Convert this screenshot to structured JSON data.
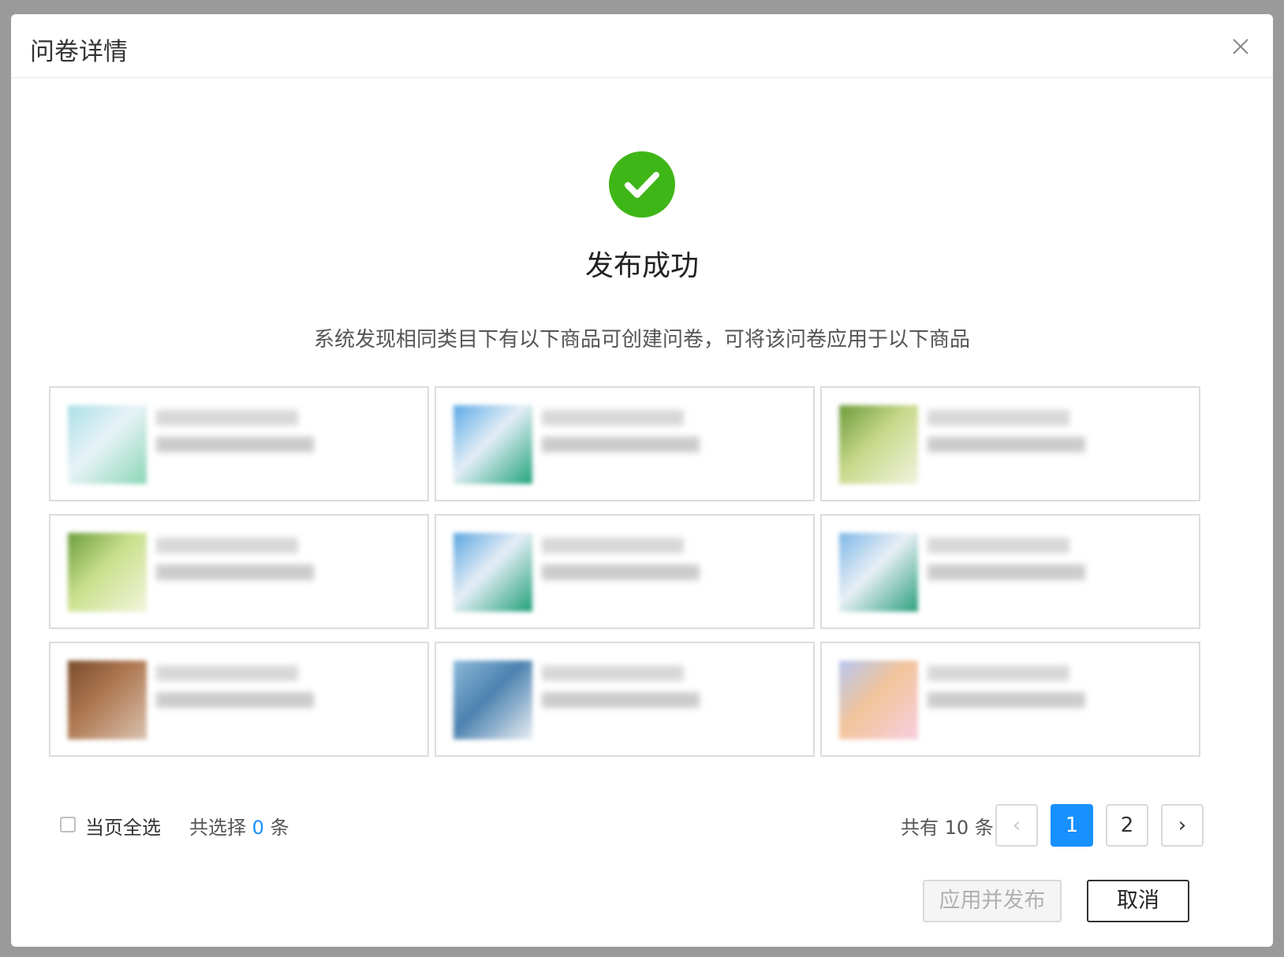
{
  "modal": {
    "title": "问卷详情",
    "success_title": "发布成功",
    "description": "系统发现相同类目下有以下商品可创建问卷，可将该问卷应用于以下商品"
  },
  "products": [
    {
      "thumb_colors": [
        "#a9dfe6",
        "#e8f3f7",
        "#8ad6b6"
      ]
    },
    {
      "thumb_colors": [
        "#5aa9e6",
        "#e3eef6",
        "#21a37a"
      ]
    },
    {
      "thumb_colors": [
        "#6b9b3a",
        "#c8d88a",
        "#f0f3df"
      ]
    },
    {
      "thumb_colors": [
        "#6a9e3b",
        "#cbe08e",
        "#f2f5dc"
      ]
    },
    {
      "thumb_colors": [
        "#5aa6e0",
        "#e6eef6",
        "#1f9f77"
      ]
    },
    {
      "thumb_colors": [
        "#7db7e8",
        "#e8eff5",
        "#2a9f7c"
      ]
    },
    {
      "thumb_colors": [
        "#7a4a2a",
        "#b07a53",
        "#d9c2b0"
      ]
    },
    {
      "thumb_colors": [
        "#8bb9d9",
        "#4c82b0",
        "#e9eef3"
      ]
    },
    {
      "thumb_colors": [
        "#b7c6f0",
        "#f2c49b",
        "#f7cfe0"
      ]
    }
  ],
  "footer": {
    "select_all_label": "当页全选",
    "selected_prefix": "共选择",
    "selected_count": "0",
    "selected_suffix": "条",
    "total_label": "共有 10 条",
    "pages": [
      "1",
      "2"
    ],
    "current_page": "1",
    "prev_icon": "‹",
    "next_icon": "›"
  },
  "actions": {
    "apply_label": "应用并发布",
    "cancel_label": "取消"
  },
  "colors": {
    "success": "#3fb618",
    "primary": "#1890ff"
  }
}
